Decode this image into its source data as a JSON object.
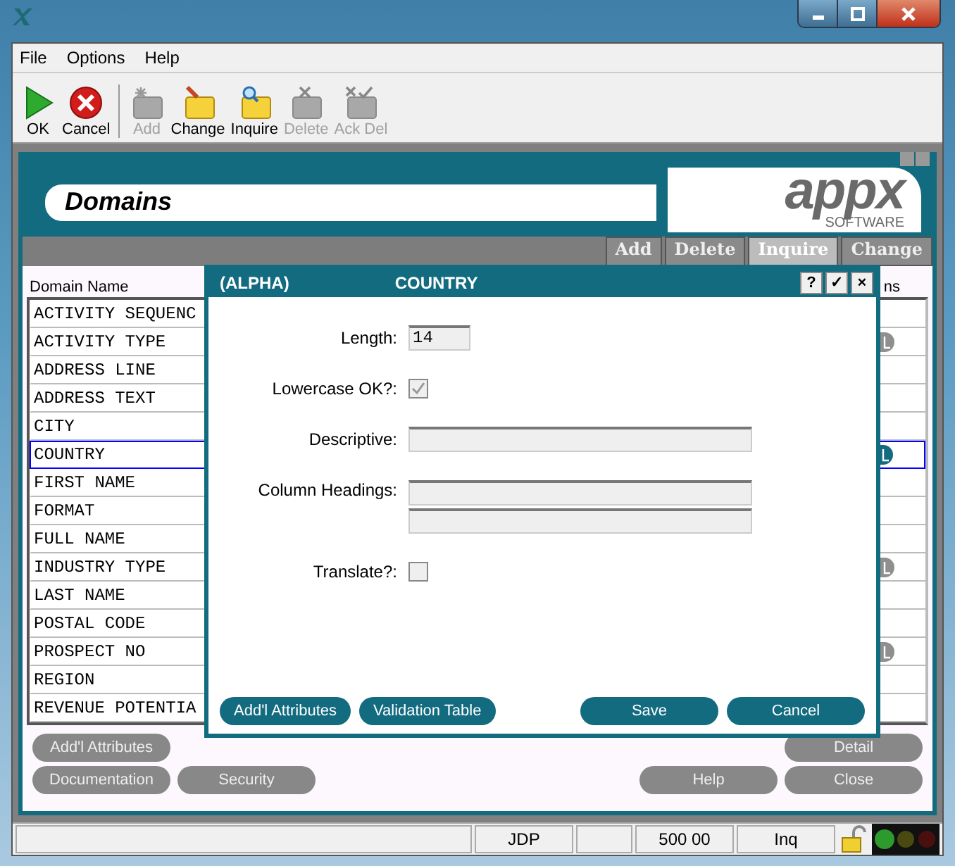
{
  "menu": [
    "File",
    "Options",
    "Help"
  ],
  "toolbar": [
    {
      "label": "OK",
      "kind": "ok",
      "disabled": false
    },
    {
      "label": "Cancel",
      "kind": "cancel",
      "disabled": false
    },
    {
      "label": "Add",
      "kind": "add",
      "disabled": true
    },
    {
      "label": "Change",
      "kind": "change",
      "disabled": false
    },
    {
      "label": "Inquire",
      "kind": "inquire",
      "disabled": false
    },
    {
      "label": "Delete",
      "kind": "delete",
      "disabled": true
    },
    {
      "label": "Ack Del",
      "kind": "ackdel",
      "disabled": true
    }
  ],
  "header": {
    "title": "Domains",
    "logo": "appx",
    "logo_sub": "SOFTWARE"
  },
  "tabs": [
    {
      "label": "Add",
      "selected": false
    },
    {
      "label": "Delete",
      "selected": false
    },
    {
      "label": "Inquire",
      "selected": true
    },
    {
      "label": "Change",
      "selected": false
    }
  ],
  "list": {
    "columns": [
      "Domain Name",
      "ns"
    ],
    "rows": [
      {
        "name": "ACTIVITY SEQUENC",
        "toggle": false,
        "selected": false
      },
      {
        "name": "ACTIVITY TYPE",
        "toggle": true,
        "selected": false
      },
      {
        "name": "ADDRESS LINE",
        "toggle": false,
        "selected": false
      },
      {
        "name": "ADDRESS TEXT",
        "toggle": false,
        "selected": false
      },
      {
        "name": "CITY",
        "toggle": false,
        "selected": false
      },
      {
        "name": "COUNTRY",
        "toggle": true,
        "selected": true
      },
      {
        "name": "FIRST NAME",
        "toggle": false,
        "selected": false
      },
      {
        "name": "FORMAT",
        "toggle": false,
        "selected": false
      },
      {
        "name": "FULL NAME",
        "toggle": false,
        "selected": false
      },
      {
        "name": "INDUSTRY TYPE",
        "toggle": true,
        "selected": false
      },
      {
        "name": "LAST NAME",
        "toggle": false,
        "selected": false
      },
      {
        "name": "POSTAL CODE",
        "toggle": false,
        "selected": false
      },
      {
        "name": "PROSPECT NO",
        "toggle": true,
        "selected": false
      },
      {
        "name": "REGION",
        "toggle": false,
        "selected": false
      },
      {
        "name": "REVENUE POTENTIA",
        "toggle": false,
        "selected": false
      }
    ]
  },
  "buttons_left": [
    [
      "Add'l Attributes"
    ],
    [
      "Documentation",
      "Security"
    ]
  ],
  "buttons_right": [
    [
      "Detail"
    ],
    [
      "Help",
      "Close"
    ]
  ],
  "dialog": {
    "type": "(ALPHA)",
    "title": "COUNTRY",
    "title_buttons": [
      "?",
      "✓",
      "×"
    ],
    "length_label": "Length:",
    "length": "14",
    "lowercase_label": "Lowercase OK?:",
    "lowercase_checked": true,
    "descriptive_label": "Descriptive:",
    "headings_label": "Column Headings:",
    "translate_label": "Translate?:",
    "translate_checked": false,
    "buttons": [
      {
        "label": "Add'l Attributes"
      },
      {
        "label": "Validation Table"
      },
      {
        "label": "Save"
      },
      {
        "label": "Cancel"
      }
    ]
  },
  "status_bar": [
    "JDP",
    "500 00",
    "Inq"
  ]
}
